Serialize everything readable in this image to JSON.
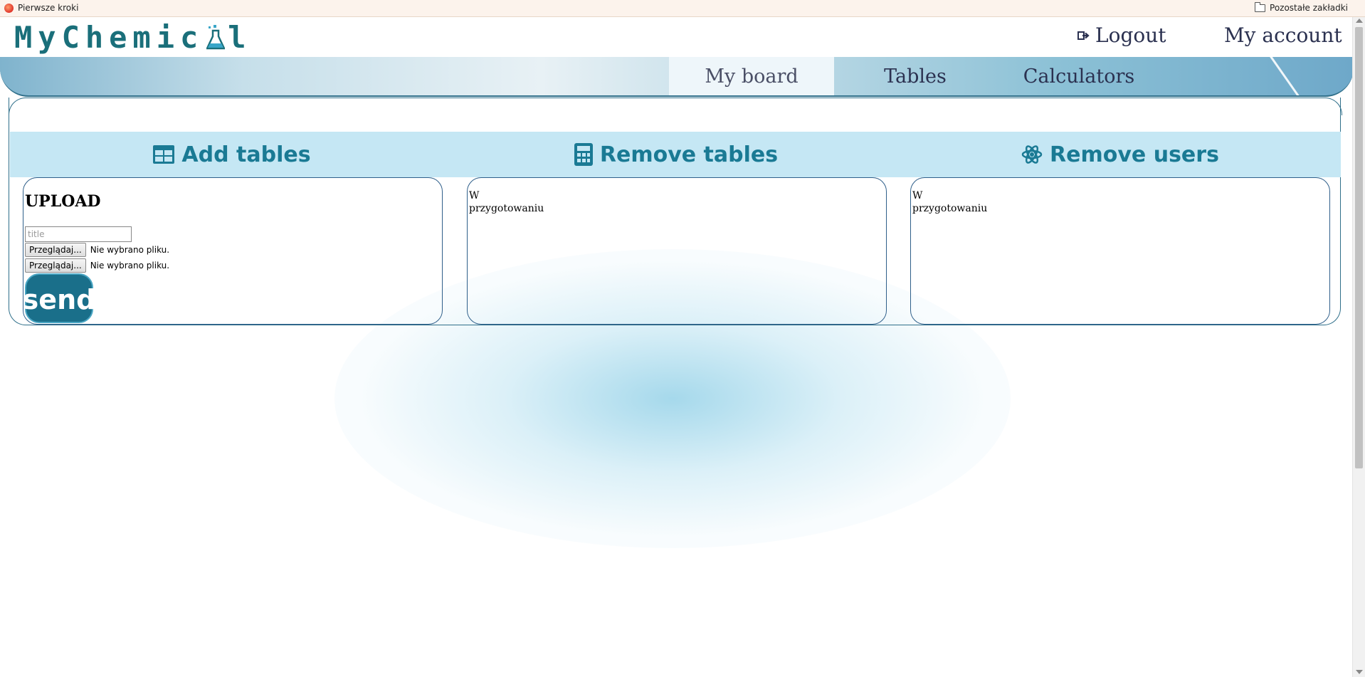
{
  "bookmarks": {
    "left_label": "Pierwsze kroki",
    "right_label": "Pozostałe zakładki"
  },
  "header": {
    "logo_prefix": "MyChemic",
    "logo_suffix": "l",
    "logout_label": "Logout",
    "account_label": "My account"
  },
  "nav": {
    "tabs": [
      {
        "label": "My board",
        "active": true
      },
      {
        "label": "Tables",
        "active": false
      },
      {
        "label": "Calculators",
        "active": false
      }
    ]
  },
  "sections": {
    "add_tables": "Add tables",
    "remove_tables": "Remove tables",
    "remove_users": "Remove users"
  },
  "upload": {
    "title": "UPLOAD",
    "title_placeholder": "title",
    "browse_label": "Przeglądaj...",
    "no_file_label": "Nie wybrano pliku.",
    "send_label": "send"
  },
  "remove_tables_card": {
    "line1": "W",
    "line2": "przygotowaniu"
  },
  "remove_users_card": {
    "line1": "W",
    "line2": "przygotowaniu"
  },
  "colors": {
    "accent": "#1a7a94",
    "send_button": "#1a6f8a",
    "section_band": "#c5e7f4",
    "nav_text": "#2b3150"
  }
}
